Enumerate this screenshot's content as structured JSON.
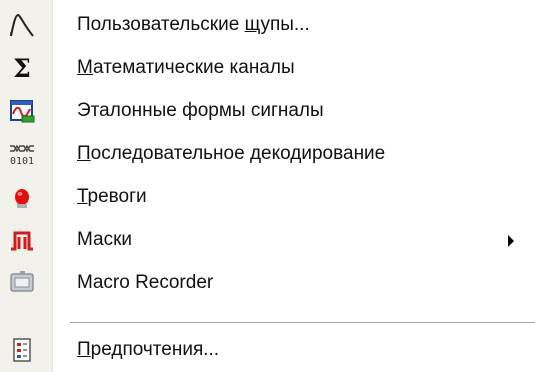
{
  "menu": {
    "items": [
      {
        "label_pre": "Пользовательские ",
        "label_u": "щ",
        "label_post": "упы...",
        "icon": "custom-probe-icon"
      },
      {
        "label_pre": "",
        "label_u": "М",
        "label_post": "атематические каналы",
        "icon": "sigma-icon"
      },
      {
        "label_pre": "Эталонные формы сигналы",
        "label_u": "",
        "label_post": "",
        "icon": "reference-waveform-icon"
      },
      {
        "label_pre": "",
        "label_u": "П",
        "label_post": "оследовательное декодирование",
        "icon": "serial-decode-icon"
      },
      {
        "label_pre": "",
        "label_u": "Т",
        "label_post": "ревоги",
        "icon": "alarm-icon"
      },
      {
        "label_pre": "Маски",
        "label_u": "",
        "label_post": "",
        "icon": "mask-icon",
        "submenu": true
      },
      {
        "label_pre": "Macro Recorder",
        "label_u": "",
        "label_post": "",
        "icon": "macro-recorder-icon"
      }
    ],
    "footer_item": {
      "label_pre": "",
      "label_u": "П",
      "label_post": "редпочтения...",
      "icon": "preferences-icon"
    }
  }
}
